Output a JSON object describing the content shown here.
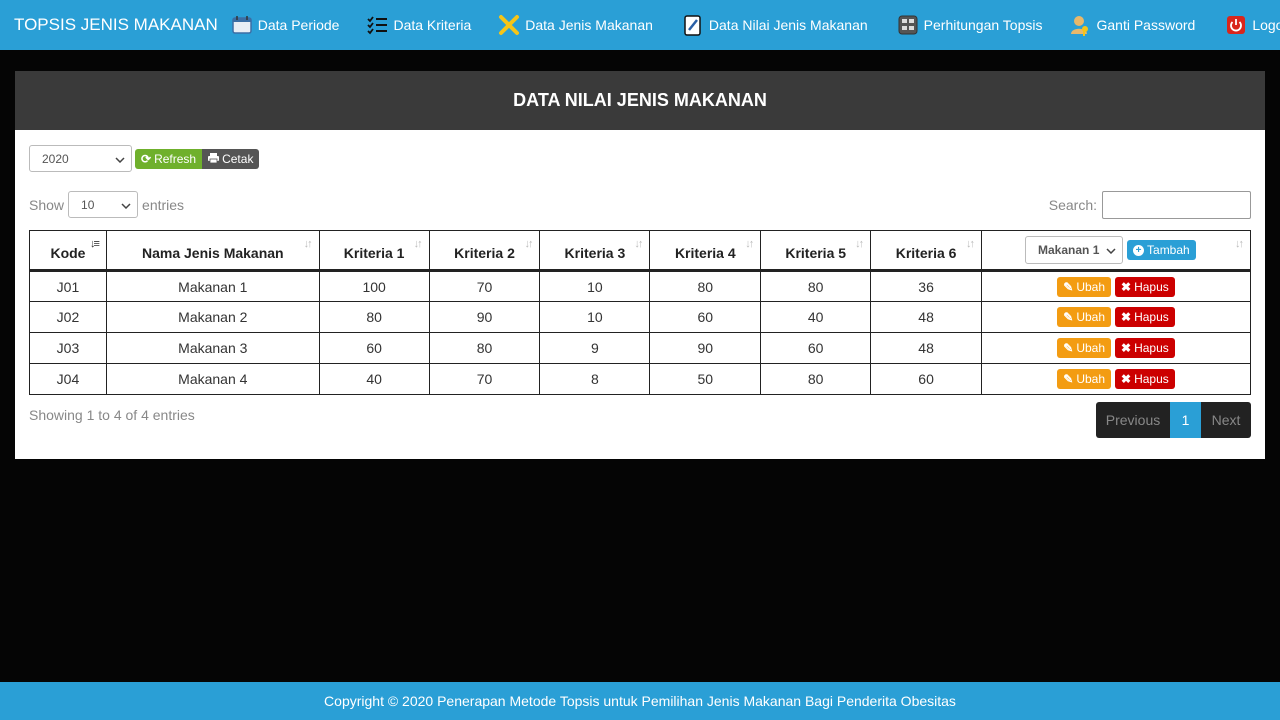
{
  "navbar": {
    "brand": "TOPSIS JENIS MAKANAN",
    "items": [
      {
        "label": "Data Periode",
        "icon": "calendar-icon"
      },
      {
        "label": "Data Kriteria",
        "icon": "checklist-icon"
      },
      {
        "label": "Data Jenis Makanan",
        "icon": "cross-icon"
      },
      {
        "label": "Data Nilai Jenis Makanan",
        "icon": "edit-icon"
      },
      {
        "label": "Perhitungan Topsis",
        "icon": "calculator-icon"
      },
      {
        "label": "Ganti Password",
        "icon": "user-key-icon"
      },
      {
        "label": "Logout",
        "icon": "power-icon"
      }
    ]
  },
  "panel": {
    "title": "DATA NILAI JENIS MAKANAN",
    "year_select": "2020",
    "refresh_label": "Refresh",
    "cetak_label": "Cetak",
    "show_label": "Show",
    "entries_label": "entries",
    "length_select": "10",
    "search_label": "Search:",
    "search_value": ""
  },
  "table": {
    "headers": [
      "Kode",
      "Nama Jenis Makanan",
      "Kriteria 1",
      "Kriteria 2",
      "Kriteria 3",
      "Kriteria 4",
      "Kriteria 5",
      "Kriteria 6"
    ],
    "makanan_select": "Makanan 1",
    "tambah_label": "Tambah",
    "ubah_label": "Ubah",
    "hapus_label": "Hapus",
    "rows": [
      [
        "J01",
        "Makanan 1",
        "100",
        "70",
        "10",
        "80",
        "80",
        "36"
      ],
      [
        "J02",
        "Makanan 2",
        "80",
        "90",
        "10",
        "60",
        "40",
        "48"
      ],
      [
        "J03",
        "Makanan 3",
        "60",
        "80",
        "9",
        "90",
        "60",
        "48"
      ],
      [
        "J04",
        "Makanan 4",
        "40",
        "70",
        "8",
        "50",
        "80",
        "60"
      ]
    ]
  },
  "pagination": {
    "info": "Showing 1 to 4 of 4 entries",
    "previous": "Previous",
    "page": "1",
    "next": "Next"
  },
  "footer": {
    "text": "Copyright © 2020 Penerapan Metode Topsis untuk Pemilihan Jenis Makanan Bagi Penderita Obesitas"
  },
  "colors": {
    "primary": "#2a9fd6",
    "success": "#6fb02c",
    "warning": "#f39c12",
    "danger": "#cc0000"
  }
}
